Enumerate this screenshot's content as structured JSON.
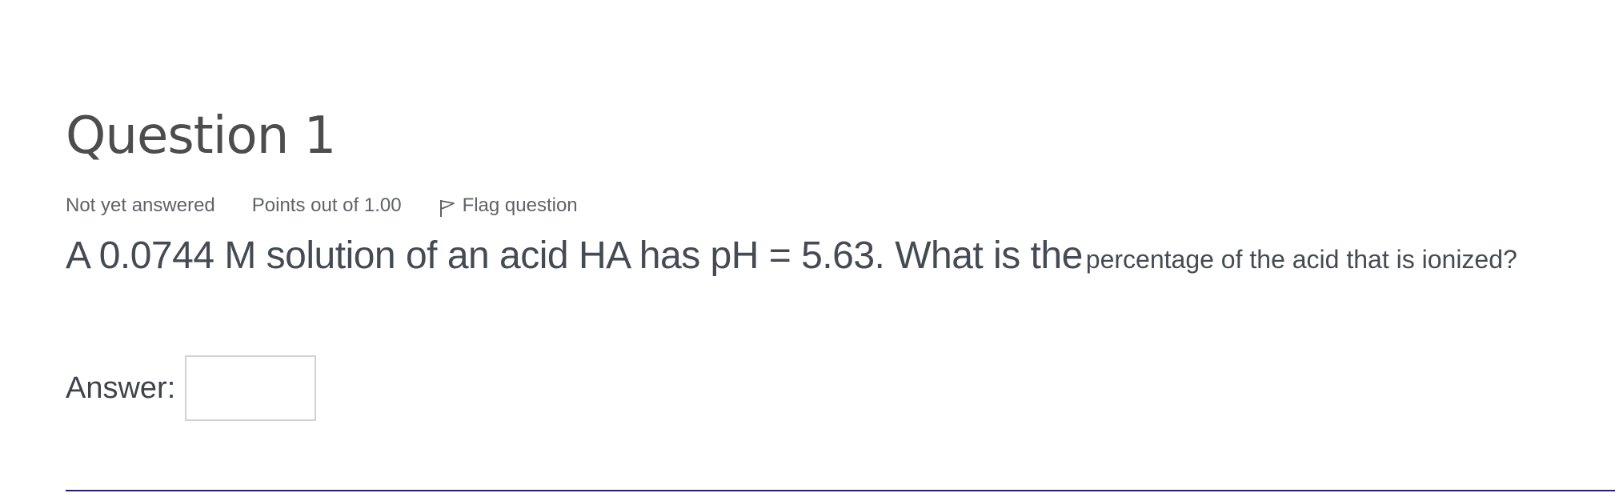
{
  "question": {
    "title": "Question 1",
    "status": "Not yet answered",
    "grade": "Points out of 1.00",
    "flag_label": "Flag question",
    "text_large": "A 0.0744 M solution of an acid HA has pH = 5.63. What is the",
    "text_small": "percentage of the acid that is ionized?"
  },
  "answer": {
    "label": "Answer:",
    "value": ""
  },
  "icons": {
    "flag": "flag-icon"
  },
  "colors": {
    "divider": "#2b1870",
    "text": "#4b4f56"
  }
}
